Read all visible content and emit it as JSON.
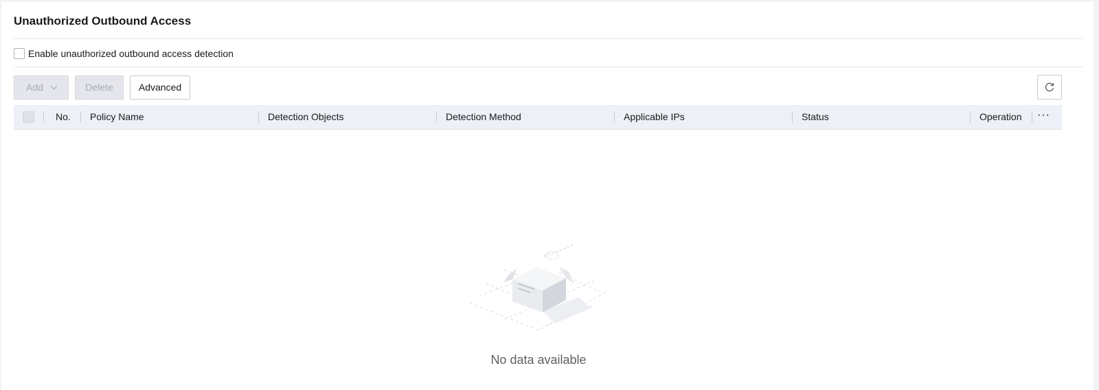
{
  "page": {
    "title": "Unauthorized Outbound Access"
  },
  "detection": {
    "enable_label": "Enable unauthorized outbound access detection",
    "enabled": false
  },
  "toolbar": {
    "add_label": "Add",
    "delete_label": "Delete",
    "advanced_label": "Advanced"
  },
  "table": {
    "columns": [
      "No.",
      "Policy Name",
      "Detection Objects",
      "Detection Method",
      "Applicable IPs",
      "Status",
      "Operation"
    ],
    "more_label": "···",
    "rows": []
  },
  "empty_state": {
    "message": "No data available"
  },
  "icons": {
    "refresh": "refresh-icon",
    "chevron": "chevron-down-icon",
    "more": "more-horizontal-icon",
    "empty": "empty-box-icon"
  },
  "colors": {
    "header_bg": "#edf0f7",
    "disabled_button_bg": "#e5e6eb",
    "text_primary": "#191919",
    "text_muted": "#5e6166"
  }
}
